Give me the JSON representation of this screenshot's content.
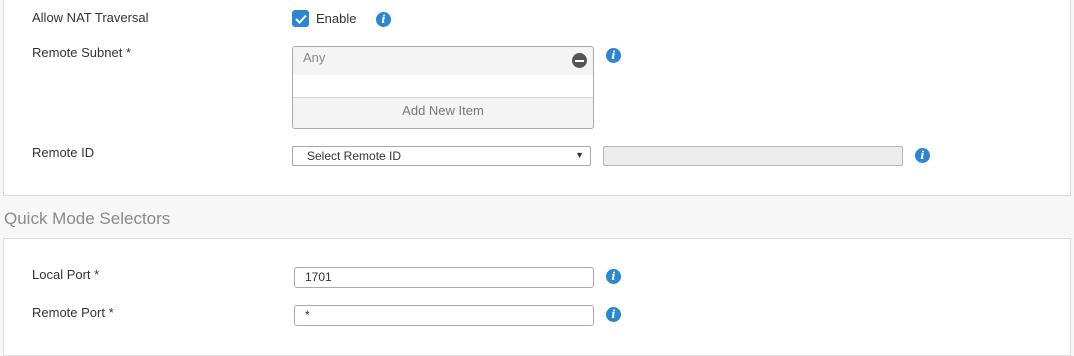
{
  "nat": {
    "label": "Allow NAT Traversal",
    "checkbox_label": "Enable",
    "checked": true
  },
  "remote_subnet": {
    "label": "Remote Subnet *",
    "items": [
      "Any"
    ],
    "add_label": "Add New Item"
  },
  "remote_id": {
    "label": "Remote ID",
    "select_value": "Select Remote ID",
    "text_value": ""
  },
  "quick_mode": {
    "heading": "Quick Mode Selectors"
  },
  "local_port": {
    "label": "Local Port *",
    "value": "1701"
  },
  "remote_port": {
    "label": "Remote Port *",
    "value": "*"
  },
  "icons": {
    "info": "i",
    "select_arrow": "▼"
  },
  "colors": {
    "accent": "#2b87d1",
    "remove": "#555555"
  }
}
